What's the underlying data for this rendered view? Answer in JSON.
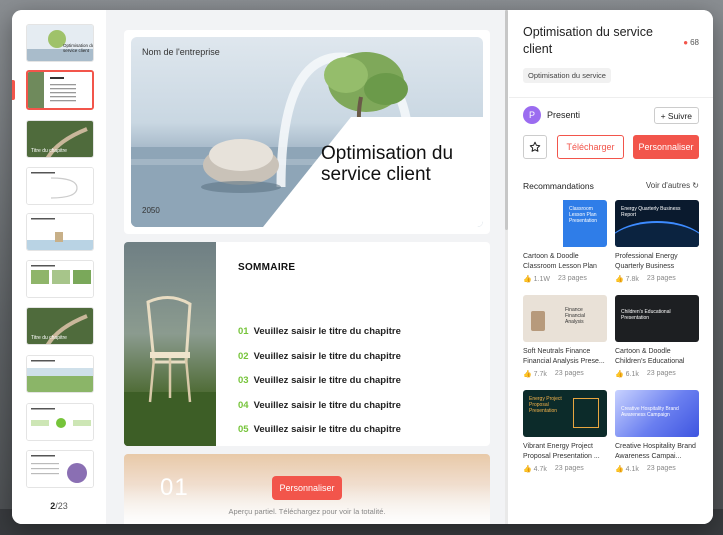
{
  "thumbnails": [
    {
      "label": "Optimisation du service client",
      "bg": "#dfe7ee"
    },
    {
      "label": "SOMMAIRE",
      "bg": "#ffffff"
    },
    {
      "label": "Titre du chapitre",
      "bg": "#4c6a3a"
    },
    {
      "label": "",
      "bg": "#ffffff"
    },
    {
      "label": "",
      "bg": "#ffffff"
    },
    {
      "label": "",
      "bg": "#ffffff"
    },
    {
      "label": "Titre du chapitre",
      "bg": "#4c6a3a"
    },
    {
      "label": "",
      "bg": "#ffffff"
    },
    {
      "label": "",
      "bg": "#ffffff"
    },
    {
      "label": "",
      "bg": "#ffffff"
    }
  ],
  "pager": {
    "current": "2",
    "separator": "/",
    "total": "23"
  },
  "slide1": {
    "company": "Nom de l'entreprise",
    "title": "Optimisation du service client",
    "year": "2050"
  },
  "slide2": {
    "title": "SOMMAIRE",
    "items": [
      {
        "num": "01",
        "text": "Veuillez saisir le titre du chapitre"
      },
      {
        "num": "02",
        "text": "Veuillez saisir le titre du chapitre"
      },
      {
        "num": "03",
        "text": "Veuillez saisir le titre du chapitre"
      },
      {
        "num": "04",
        "text": "Veuillez saisir le titre du chapitre"
      },
      {
        "num": "05",
        "text": "Veuillez saisir le titre du chapitre"
      }
    ]
  },
  "slide3": {
    "num": "01"
  },
  "preview": {
    "cta": "Personnaliser",
    "note": "Aperçu partiel. Téléchargez pour voir la totalité."
  },
  "panel": {
    "title": "Optimisation du service client",
    "likes": "68",
    "tag": "Optimisation du service",
    "author_initial": "P",
    "author": "Presenti",
    "follow": "Suivre",
    "download": "Télécharger",
    "customize": "Personnaliser",
    "rec_title": "Recommandations",
    "rec_more": "Voir d'autres"
  },
  "recommendations": [
    {
      "title": "Cartoon & Doodle Classroom Lesson Plan Pre...",
      "views": "1.1W",
      "pages": "23 pages",
      "thumb_text": "Classroom Lesson Plan Presentation",
      "bg": "#2f7de8"
    },
    {
      "title": "Professional Energy Quarterly Business Repor...",
      "views": "7.8k",
      "pages": "23 pages",
      "thumb_text": "Energy Quarterly Business Report",
      "bg": "#0a1a2e"
    },
    {
      "title": "Soft Neutrals Finance Financial Analysis Prese...",
      "views": "7.7k",
      "pages": "23 pages",
      "thumb_text": "Finance Financial Analysis",
      "bg": "#e9e1d7"
    },
    {
      "title": "Cartoon & Doodle Children's Educational Prese...",
      "views": "6.1k",
      "pages": "23 pages",
      "thumb_text": "Children's Educational Presentation",
      "bg": "#1d1f22"
    },
    {
      "title": "Vibrant Energy Project Proposal Presentation ...",
      "views": "4.7k",
      "pages": "23 pages",
      "thumb_text": "Energy Project Proposal Presentation",
      "bg": "#0c2b2a"
    },
    {
      "title": "Creative Hospitality Brand Awareness Campai...",
      "views": "4.1k",
      "pages": "23 pages",
      "thumb_text": "Creative Hospitality Brand Awareness Campaign",
      "bg": "#4b63e6"
    }
  ],
  "colors": {
    "accent": "#f2554b",
    "green": "#76c43a"
  }
}
